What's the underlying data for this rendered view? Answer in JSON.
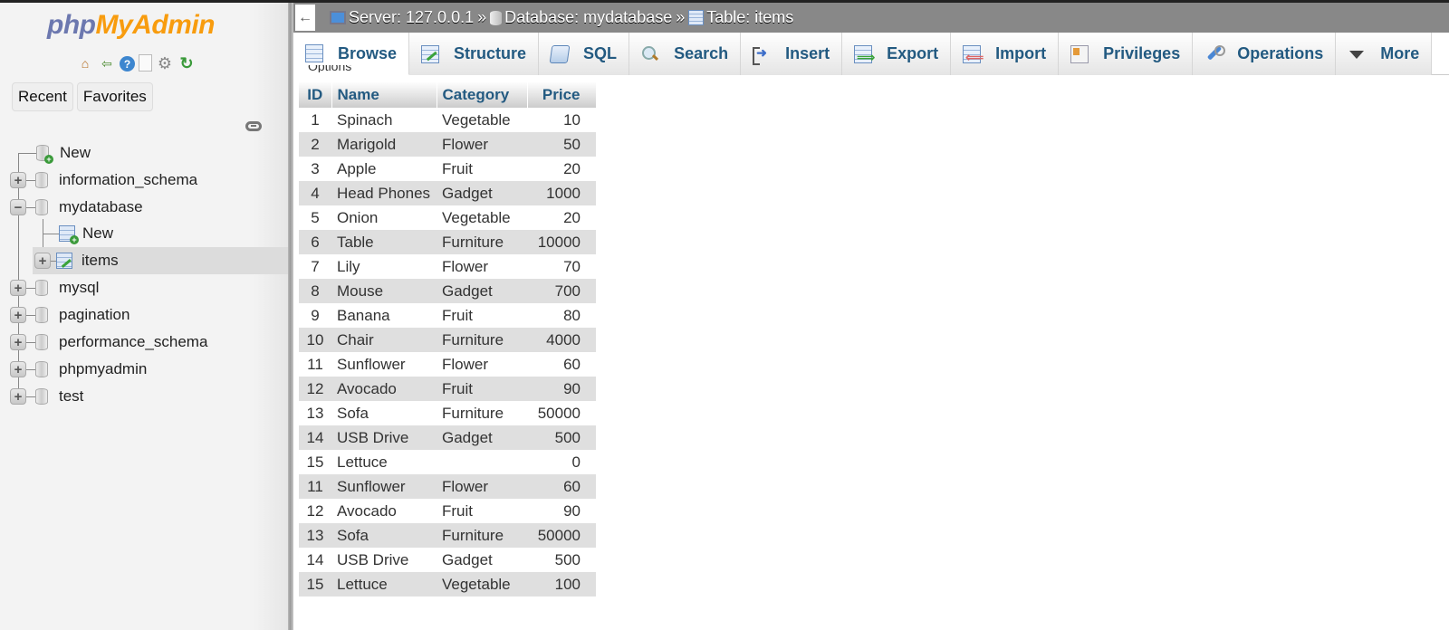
{
  "sidebar": {
    "logo": {
      "part1": "php",
      "part2": "MyAdmin"
    },
    "quick_icons": [
      "home-icon",
      "logout-icon",
      "help-icon",
      "documentation-icon",
      "settings-icon",
      "reload-icon"
    ],
    "buttons": {
      "recent": "Recent",
      "favorites": "Favorites"
    },
    "tree": [
      {
        "label": "New",
        "type": "new-database",
        "level": 0
      },
      {
        "label": "information_schema",
        "type": "database",
        "level": 0,
        "expanded": false
      },
      {
        "label": "mydatabase",
        "type": "database",
        "level": 0,
        "expanded": true
      },
      {
        "label": "New",
        "type": "new-table",
        "level": 1
      },
      {
        "label": "items",
        "type": "table",
        "level": 1,
        "selected": true
      },
      {
        "label": "mysql",
        "type": "database",
        "level": 0,
        "expanded": false
      },
      {
        "label": "pagination",
        "type": "database",
        "level": 0,
        "expanded": false
      },
      {
        "label": "performance_schema",
        "type": "database",
        "level": 0,
        "expanded": false
      },
      {
        "label": "phpmyadmin",
        "type": "database",
        "level": 0,
        "expanded": false
      },
      {
        "label": "test",
        "type": "database",
        "level": 0,
        "expanded": false
      }
    ]
  },
  "breadcrumb": {
    "back": "←",
    "server": "Server: 127.0.0.1",
    "database": "Database: mydatabase",
    "table": "Table: items",
    "separator": "»"
  },
  "tabs": [
    {
      "label": "Browse",
      "icon": "browse-icon",
      "active": true
    },
    {
      "label": "Structure",
      "icon": "structure-icon"
    },
    {
      "label": "SQL",
      "icon": "sql-icon"
    },
    {
      "label": "Search",
      "icon": "search-icon"
    },
    {
      "label": "Insert",
      "icon": "insert-icon"
    },
    {
      "label": "Export",
      "icon": "export-icon"
    },
    {
      "label": "Import",
      "icon": "import-icon"
    },
    {
      "label": "Privileges",
      "icon": "privileges-icon"
    },
    {
      "label": "Operations",
      "icon": "operations-icon"
    },
    {
      "label": "More",
      "icon": "more-dropdown-icon"
    }
  ],
  "options_label": "Options",
  "table": {
    "columns": [
      "ID",
      "Name",
      "Category",
      "Price"
    ],
    "rows": [
      [
        "1",
        "Spinach",
        "Vegetable",
        "10"
      ],
      [
        "2",
        "Marigold",
        "Flower",
        "50"
      ],
      [
        "3",
        "Apple",
        "Fruit",
        "20"
      ],
      [
        "4",
        "Head Phones",
        "Gadget",
        "1000"
      ],
      [
        "5",
        "Onion",
        "Vegetable",
        "20"
      ],
      [
        "6",
        "Table",
        "Furniture",
        "10000"
      ],
      [
        "7",
        "Lily",
        "Flower",
        "70"
      ],
      [
        "8",
        "Mouse",
        "Gadget",
        "700"
      ],
      [
        "9",
        "Banana",
        "Fruit",
        "80"
      ],
      [
        "10",
        "Chair",
        "Furniture",
        "4000"
      ],
      [
        "11",
        "Sunflower",
        "Flower",
        "60"
      ],
      [
        "12",
        "Avocado",
        "Fruit",
        "90"
      ],
      [
        "13",
        "Sofa",
        "Furniture",
        "50000"
      ],
      [
        "14",
        "USB Drive",
        "Gadget",
        "500"
      ],
      [
        "15",
        "Lettuce",
        "",
        "0"
      ],
      [
        "11",
        "Sunflower",
        "Flower",
        "60"
      ],
      [
        "12",
        "Avocado",
        "Fruit",
        "90"
      ],
      [
        "13",
        "Sofa",
        "Furniture",
        "50000"
      ],
      [
        "14",
        "USB Drive",
        "Gadget",
        "500"
      ],
      [
        "15",
        "Lettuce",
        "Vegetable",
        "100"
      ]
    ]
  },
  "colors": {
    "logo_php": "#6c78af",
    "logo_myadmin": "#f89c0e",
    "tab_text": "#235a81",
    "crumb_bar": "#888888",
    "row_alt": "#dfdfdf"
  }
}
